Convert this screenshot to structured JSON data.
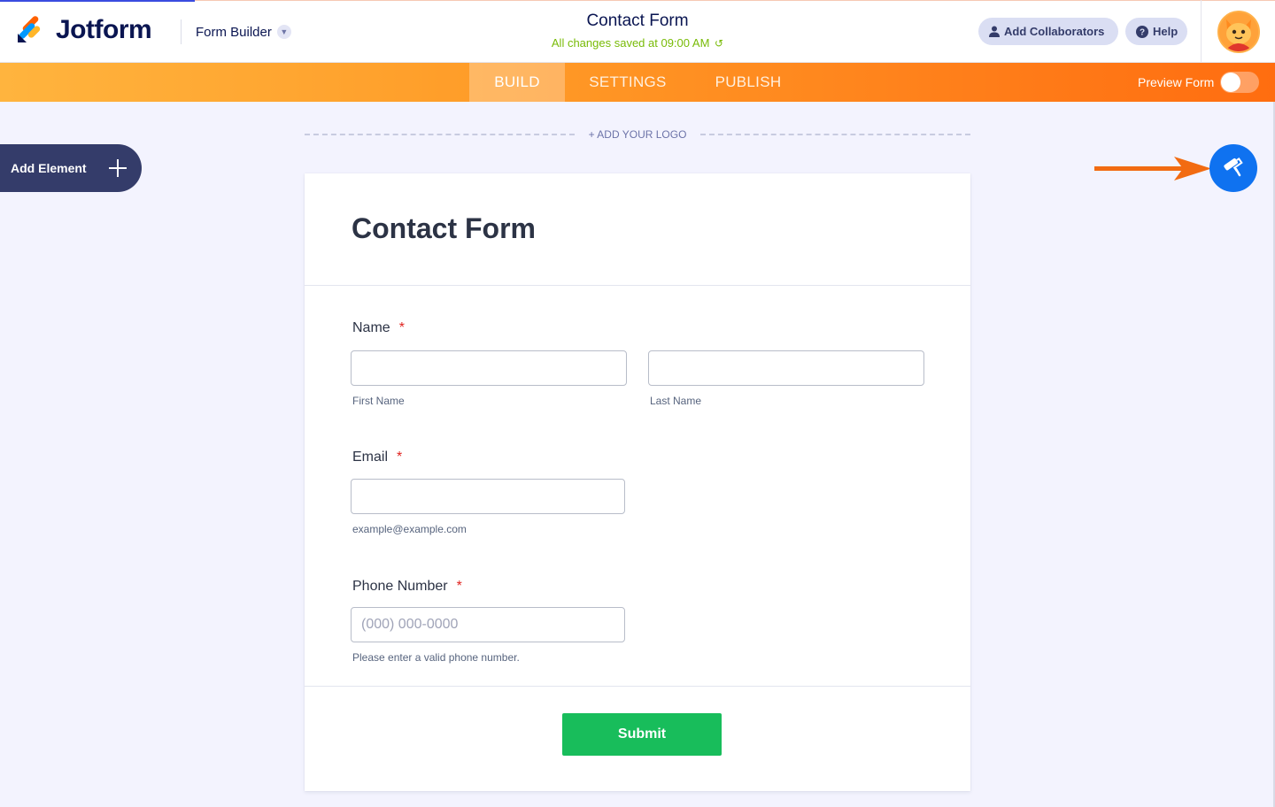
{
  "header": {
    "logo_text": "Jotform",
    "builder_label": "Form Builder",
    "form_title": "Contact Form",
    "save_status": "All changes saved at 09:00 AM",
    "add_collaborators_label": "Add Collaborators",
    "help_label": "Help"
  },
  "nav": {
    "tabs": [
      {
        "label": "BUILD",
        "active": true
      },
      {
        "label": "SETTINGS",
        "active": false
      },
      {
        "label": "PUBLISH",
        "active": false
      }
    ],
    "preview_label": "Preview Form",
    "preview_on": false
  },
  "canvas": {
    "add_logo_label": "+ ADD YOUR LOGO",
    "add_element_label": "Add Element"
  },
  "form": {
    "heading": "Contact Form",
    "fields": {
      "name": {
        "label": "Name",
        "required_mark": "*",
        "first_sublabel": "First Name",
        "last_sublabel": "Last Name"
      },
      "email": {
        "label": "Email",
        "required_mark": "*",
        "sublabel": "example@example.com"
      },
      "phone": {
        "label": "Phone Number",
        "required_mark": "*",
        "placeholder": "(000) 000-0000",
        "sublabel": "Please enter a valid phone number."
      }
    },
    "submit_label": "Submit"
  },
  "colors": {
    "brand_navy": "#0a1551",
    "nav_orange_start": "#ffb43e",
    "nav_orange_end": "#ff6d10",
    "designer_blue": "#0f72f0",
    "submit_green": "#18bd5b",
    "annotation_arrow": "#f26b12",
    "saved_green": "#78bb07"
  },
  "icons": {
    "logo": "jotform-logo-icon",
    "builder_dropdown": "chevron-down-icon",
    "save_refresh": "refresh-icon",
    "collaborators": "user-icon",
    "help": "question-circle-icon",
    "add_element": "plus-icon",
    "designer": "paint-roller-icon",
    "annotation": "arrow-right-icon"
  }
}
